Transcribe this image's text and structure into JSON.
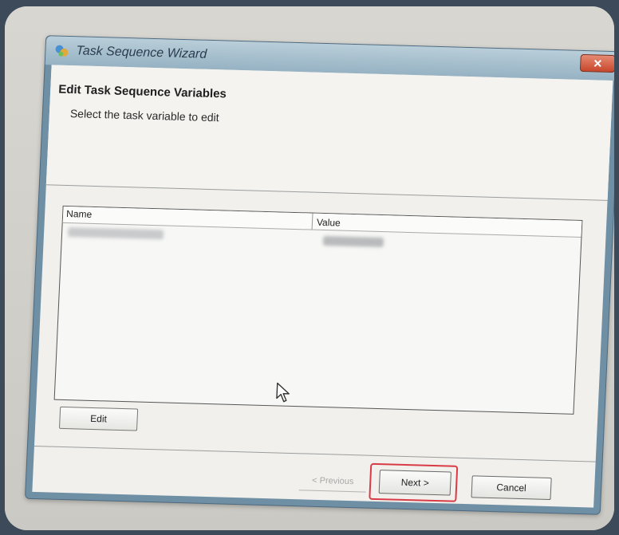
{
  "window": {
    "title": "Task Sequence Wizard",
    "close_glyph": "✕",
    "icon": "task-sequence-wizard-icon"
  },
  "header": {
    "title": "Edit Task Sequence Variables",
    "subtitle": "Select the task variable to edit"
  },
  "list": {
    "columns": [
      "Name",
      "Value"
    ]
  },
  "buttons": {
    "edit": "Edit",
    "previous": "< Previous",
    "next": "Next >",
    "cancel": "Cancel"
  },
  "colors": {
    "highlight": "#d93b46",
    "title_bar": "#96b2c3"
  }
}
